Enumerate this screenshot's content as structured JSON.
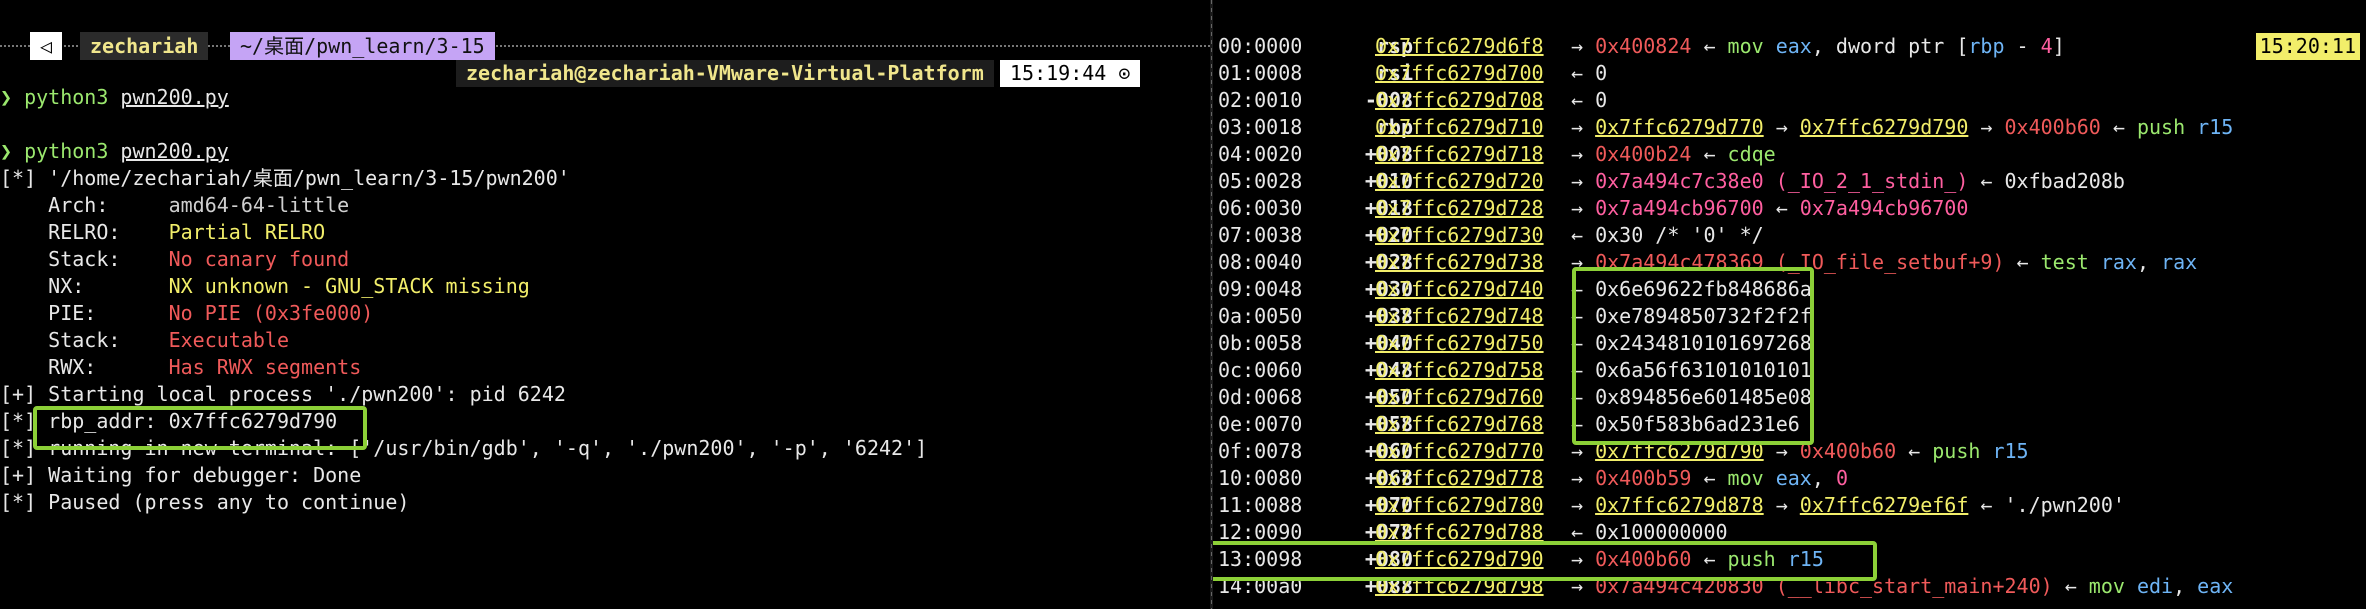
{
  "prompt": {
    "tri_icon": "◁",
    "user": "zechariah",
    "path": "~/桌面/pwn_learn/3-15",
    "host": "zechariah@zechariah-VMware-Virtual-Platform",
    "time": "15:19:44 ⊙"
  },
  "terminal": {
    "lines": [
      {
        "prefix": "❯ ",
        "cmd": "python3",
        "arg": "pwn200.py"
      },
      {
        "blank": true
      },
      {
        "prefix": "❯ ",
        "cmd": "python3",
        "arg": "pwn200.py"
      },
      {
        "text": "[*] '/home/zechariah/桌面/pwn_learn/3-15/pwn200'"
      },
      {
        "label": "    Arch:     ",
        "value": "amd64-64-little",
        "cls": "dim"
      },
      {
        "label": "    RELRO:    ",
        "value": "Partial RELRO",
        "cls": "yel"
      },
      {
        "label": "    Stack:    ",
        "value": "No canary found",
        "cls": "red"
      },
      {
        "label": "    NX:       ",
        "value": "NX unknown - GNU_STACK missing",
        "cls": "yel"
      },
      {
        "label": "    PIE:      ",
        "value": "No PIE (0x3fe000)",
        "cls": "red"
      },
      {
        "label": "    Stack:    ",
        "value": "Executable",
        "cls": "red"
      },
      {
        "label": "    RWX:      ",
        "value": "Has RWX segments",
        "cls": "red"
      },
      {
        "text": "[+] Starting local process './pwn200': pid 6242"
      },
      {
        "text": "[*] rbp_addr: 0x7ffc6279d790"
      },
      {
        "text": "[*] running in new terminal: ['/usr/bin/gdb', '-q', './pwn200', '-p', '6242']"
      },
      {
        "text": "[+] Waiting for debugger: Done"
      },
      {
        "text": "[*] Paused (press any to continue)"
      }
    ]
  },
  "stack": {
    "time": "15:20:11",
    "rows": [
      {
        "idx": "00:0000",
        "reg": "rsp",
        "addr": "0x7ffc6279d6f8",
        "rest": [
          [
            "→ ",
            "w"
          ],
          [
            "0x400824",
            "r"
          ],
          [
            " ← ",
            "w"
          ],
          [
            "mov ",
            "g"
          ],
          [
            "eax",
            "b"
          ],
          [
            ", dword ptr [",
            "w"
          ],
          [
            "rbp",
            "b"
          ],
          [
            " - ",
            "w"
          ],
          [
            "4",
            "m"
          ],
          [
            "]",
            "w"
          ]
        ]
      },
      {
        "idx": "01:0008",
        "reg": "rsi",
        "addr": "0x7ffc6279d700",
        "rest": [
          [
            "← 0",
            "w"
          ]
        ]
      },
      {
        "idx": "02:0010",
        "reg": "-008",
        "addr": "0x7ffc6279d708",
        "rest": [
          [
            "← 0",
            "w"
          ]
        ]
      },
      {
        "idx": "03:0018",
        "reg": "rbp",
        "addr": "0x7ffc6279d710",
        "rest": [
          [
            "→ ",
            "w"
          ],
          [
            "0x7ffc6279d770",
            "yu"
          ],
          [
            " → ",
            "w"
          ],
          [
            "0x7ffc6279d790",
            "yu"
          ],
          [
            " → ",
            "w"
          ],
          [
            "0x400b60",
            "r"
          ],
          [
            " ← ",
            "w"
          ],
          [
            "push ",
            "g"
          ],
          [
            "r15",
            "b"
          ]
        ]
      },
      {
        "idx": "04:0020",
        "reg": "+008",
        "addr": "0x7ffc6279d718",
        "rest": [
          [
            "→ ",
            "w"
          ],
          [
            "0x400b24",
            "r"
          ],
          [
            " ← ",
            "w"
          ],
          [
            "cdqe",
            "g"
          ]
        ]
      },
      {
        "idx": "05:0028",
        "reg": "+010",
        "addr": "0x7ffc6279d720",
        "rest": [
          [
            "→ ",
            "w"
          ],
          [
            "0x7a494c7c38e0 (_IO_2_1_stdin_)",
            "m"
          ],
          [
            " ← 0xfbad208b",
            "w"
          ]
        ]
      },
      {
        "idx": "06:0030",
        "reg": "+018",
        "addr": "0x7ffc6279d728",
        "rest": [
          [
            "→ ",
            "w"
          ],
          [
            "0x7a494cb96700",
            "m"
          ],
          [
            " ← ",
            "w"
          ],
          [
            "0x7a494cb96700",
            "m"
          ]
        ]
      },
      {
        "idx": "07:0038",
        "reg": "+020",
        "addr": "0x7ffc6279d730",
        "rest": [
          [
            "← 0x30 /* '0' */",
            "w"
          ]
        ]
      },
      {
        "idx": "08:0040",
        "reg": "+028",
        "addr": "0x7ffc6279d738",
        "rest": [
          [
            "→ ",
            "w"
          ],
          [
            "0x7a494c478369 (_IO_file_setbuf+9)",
            "r"
          ],
          [
            " ← ",
            "w"
          ],
          [
            "test ",
            "g"
          ],
          [
            "rax",
            "b"
          ],
          [
            ", ",
            "w"
          ],
          [
            "rax",
            "b"
          ]
        ]
      },
      {
        "idx": "09:0048",
        "reg": "+030",
        "addr": "0x7ffc6279d740",
        "rest": [
          [
            "← 0x6e69622fb848686a",
            "w"
          ]
        ]
      },
      {
        "idx": "0a:0050",
        "reg": "+038",
        "addr": "0x7ffc6279d748",
        "rest": [
          [
            "← 0xe7894850732f2f2f",
            "w"
          ]
        ]
      },
      {
        "idx": "0b:0058",
        "reg": "+040",
        "addr": "0x7ffc6279d750",
        "rest": [
          [
            "← 0x2434810101697268",
            "w"
          ]
        ]
      },
      {
        "idx": "0c:0060",
        "reg": "+048",
        "addr": "0x7ffc6279d758",
        "rest": [
          [
            "← 0x6a56f63101010101",
            "w"
          ]
        ]
      },
      {
        "idx": "0d:0068",
        "reg": "+050",
        "addr": "0x7ffc6279d760",
        "rest": [
          [
            "← 0x894856e601485e08",
            "w"
          ]
        ]
      },
      {
        "idx": "0e:0070",
        "reg": "+058",
        "addr": "0x7ffc6279d768",
        "rest": [
          [
            "← 0x50f583b6ad231e6",
            "w"
          ]
        ]
      },
      {
        "idx": "0f:0078",
        "reg": "+060",
        "addr": "0x7ffc6279d770",
        "rest": [
          [
            "→ ",
            "w"
          ],
          [
            "0x7ffc6279d790",
            "yu"
          ],
          [
            " → ",
            "w"
          ],
          [
            "0x400b60",
            "r"
          ],
          [
            " ← ",
            "w"
          ],
          [
            "push ",
            "g"
          ],
          [
            "r15",
            "b"
          ]
        ]
      },
      {
        "idx": "10:0080",
        "reg": "+068",
        "addr": "0x7ffc6279d778",
        "rest": [
          [
            "→ ",
            "w"
          ],
          [
            "0x400b59",
            "r"
          ],
          [
            " ← ",
            "w"
          ],
          [
            "mov ",
            "g"
          ],
          [
            "eax",
            "b"
          ],
          [
            ", ",
            "w"
          ],
          [
            "0",
            "m"
          ]
        ]
      },
      {
        "idx": "11:0088",
        "reg": "+070",
        "addr": "0x7ffc6279d780",
        "rest": [
          [
            "→ ",
            "w"
          ],
          [
            "0x7ffc6279d878",
            "yu"
          ],
          [
            " → ",
            "w"
          ],
          [
            "0x7ffc6279ef6f",
            "yu"
          ],
          [
            " ← './pwn200'",
            "w"
          ]
        ]
      },
      {
        "idx": "12:0090",
        "reg": "+078",
        "addr": "0x7ffc6279d788",
        "rest": [
          [
            "← 0x100000000",
            "w"
          ]
        ]
      },
      {
        "idx": "13:0098",
        "reg": "+080",
        "addr": "0x7ffc6279d790",
        "rest": [
          [
            "→ ",
            "w"
          ],
          [
            "0x400b60",
            "r"
          ],
          [
            " ← ",
            "w"
          ],
          [
            "push ",
            "g"
          ],
          [
            "r15",
            "b"
          ]
        ]
      },
      {
        "idx": "14:00a0",
        "reg": "+088",
        "addr": "0x7ffc6279d798",
        "rest": [
          [
            "→ ",
            "w"
          ],
          [
            "0x7a494c420830 (__libc_start_main+240)",
            "r"
          ],
          [
            " ← ",
            "w"
          ],
          [
            "mov ",
            "g"
          ],
          [
            "edi",
            "b"
          ],
          [
            ", ",
            "w"
          ],
          [
            "eax",
            "b"
          ]
        ]
      }
    ]
  }
}
